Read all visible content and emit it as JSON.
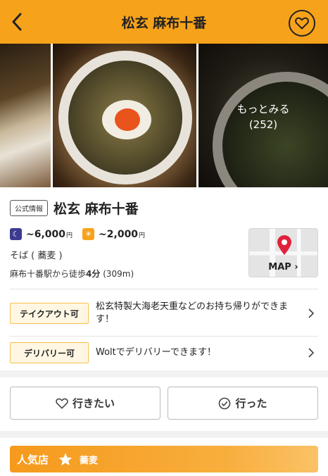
{
  "header": {
    "title": "松玄 麻布十番"
  },
  "photos": {
    "more_label": "もっとみる",
    "count": "(252)"
  },
  "info": {
    "official_tag": "公式情報",
    "name": "松玄 麻布十番",
    "dinner_price": "~6,000",
    "lunch_price": "~2,000",
    "yen": "円",
    "genre": "そば ( 蕎麦 )",
    "access_prefix": "麻布十番駅から徒歩",
    "access_minutes": "4分",
    "access_distance": " (309m)"
  },
  "map": {
    "label": "MAP ›"
  },
  "services": [
    {
      "tag": "テイクアウト可",
      "text": "松玄特製大海老天重などのお持ち帰りができます！"
    },
    {
      "tag": "デリバリー可",
      "text": "Woltでデリバリーできます！"
    }
  ],
  "actions": {
    "want_label": "行きたい",
    "been_label": "行った"
  },
  "popular": {
    "label": "人気店",
    "genre": "蕎麦"
  },
  "colors": {
    "accent": "#f7a21b",
    "night_icon": "#3d3a8f",
    "pin": "#e0213c"
  }
}
